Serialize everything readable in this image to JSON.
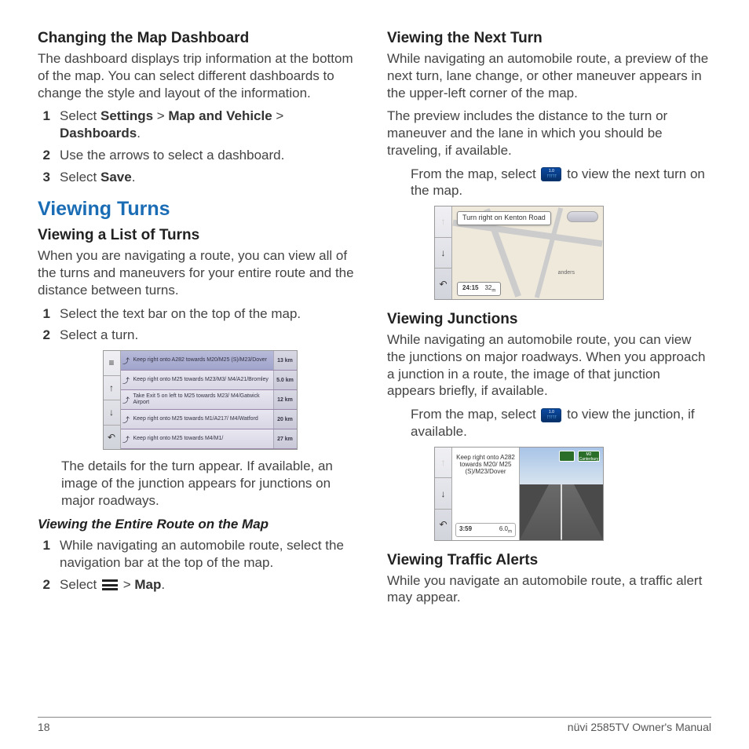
{
  "footer": {
    "page": "18",
    "manual": "nüvi 2585TV Owner's Manual"
  },
  "left": {
    "h_dashboard": "Changing the Map Dashboard",
    "p_dashboard": "The dashboard displays trip information at the bottom of the map. You can select different dashboards to change the style and layout of the information.",
    "steps_dashboard": {
      "s1a": "Select ",
      "s1b": "Settings",
      "s1c": " > ",
      "s1d": "Map and Vehicle",
      "s1e": " > ",
      "s1f": "Dashboards",
      "s1g": ".",
      "s2": "Use the arrows to select a dashboard.",
      "s3a": "Select ",
      "s3b": "Save",
      "s3c": "."
    },
    "h_section": "Viewing Turns",
    "h_list": "Viewing a List of Turns",
    "p_list": "When you are navigating a route, you can view all of the turns and maneuvers for your entire route and the distance between turns.",
    "steps_list": {
      "s1": "Select the text bar on the top of the map.",
      "s2": "Select a turn."
    },
    "p_list2": "The details for the turn appear. If available, an image of the junction appears for junctions on major roadways.",
    "h_entire": "Viewing the Entire Route on the Map",
    "steps_entire": {
      "s1": "While navigating an automobile route, select the navigation bar at the top of the map.",
      "s2a": "Select ",
      "s2b": " > ",
      "s2c": "Map",
      "s2d": "."
    },
    "mock_rows": [
      {
        "text": "Keep right onto A282 towards M20/M25 (S)/M23/Dover",
        "dist": "13 km"
      },
      {
        "text": "Keep right onto M25 towards M23/M3/ M4/A21/Bromley",
        "dist": "5.0 km"
      },
      {
        "text": "Take Exit 5 on left to M25 towards M23/ M4/Gatwick Airport",
        "dist": "12 km"
      },
      {
        "text": "Keep right onto M25 towards M1/A217/ M4/Watford",
        "dist": "20 km"
      },
      {
        "text": "Keep right onto M25 towards M4/M1/",
        "dist": "27 km"
      }
    ]
  },
  "right": {
    "h_next": "Viewing the Next Turn",
    "p_next1": "While navigating an automobile route, a preview of the next turn, lane change, or other maneuver appears in the upper-left corner of the map.",
    "p_next2": "The preview includes the distance to the turn or maneuver and the lane in which you should be traveling, if available.",
    "p_next3a": "From the map, select ",
    "p_next3b": " to view the next turn on the map.",
    "mock2_info": "Turn right on Kenton Road",
    "mock2_time": "24:15",
    "mock2_dist": "32",
    "h_junc": "Viewing Junctions",
    "p_junc": "While navigating an automobile route, you can view the junctions on major roadways. When you approach a junction in a route, the image of that junction appears briefly, if available.",
    "p_junc2a": "From the map, select ",
    "p_junc2b": " to view the junction, if available.",
    "mock3_info": "Keep right onto A282 towards M20/ M25 (S)/M23/Dover",
    "mock3_time": "3:59",
    "mock3_dist": "6.0",
    "h_traffic": "Viewing Traffic Alerts",
    "p_traffic": "While you navigate an automobile route, a traffic alert may appear."
  }
}
